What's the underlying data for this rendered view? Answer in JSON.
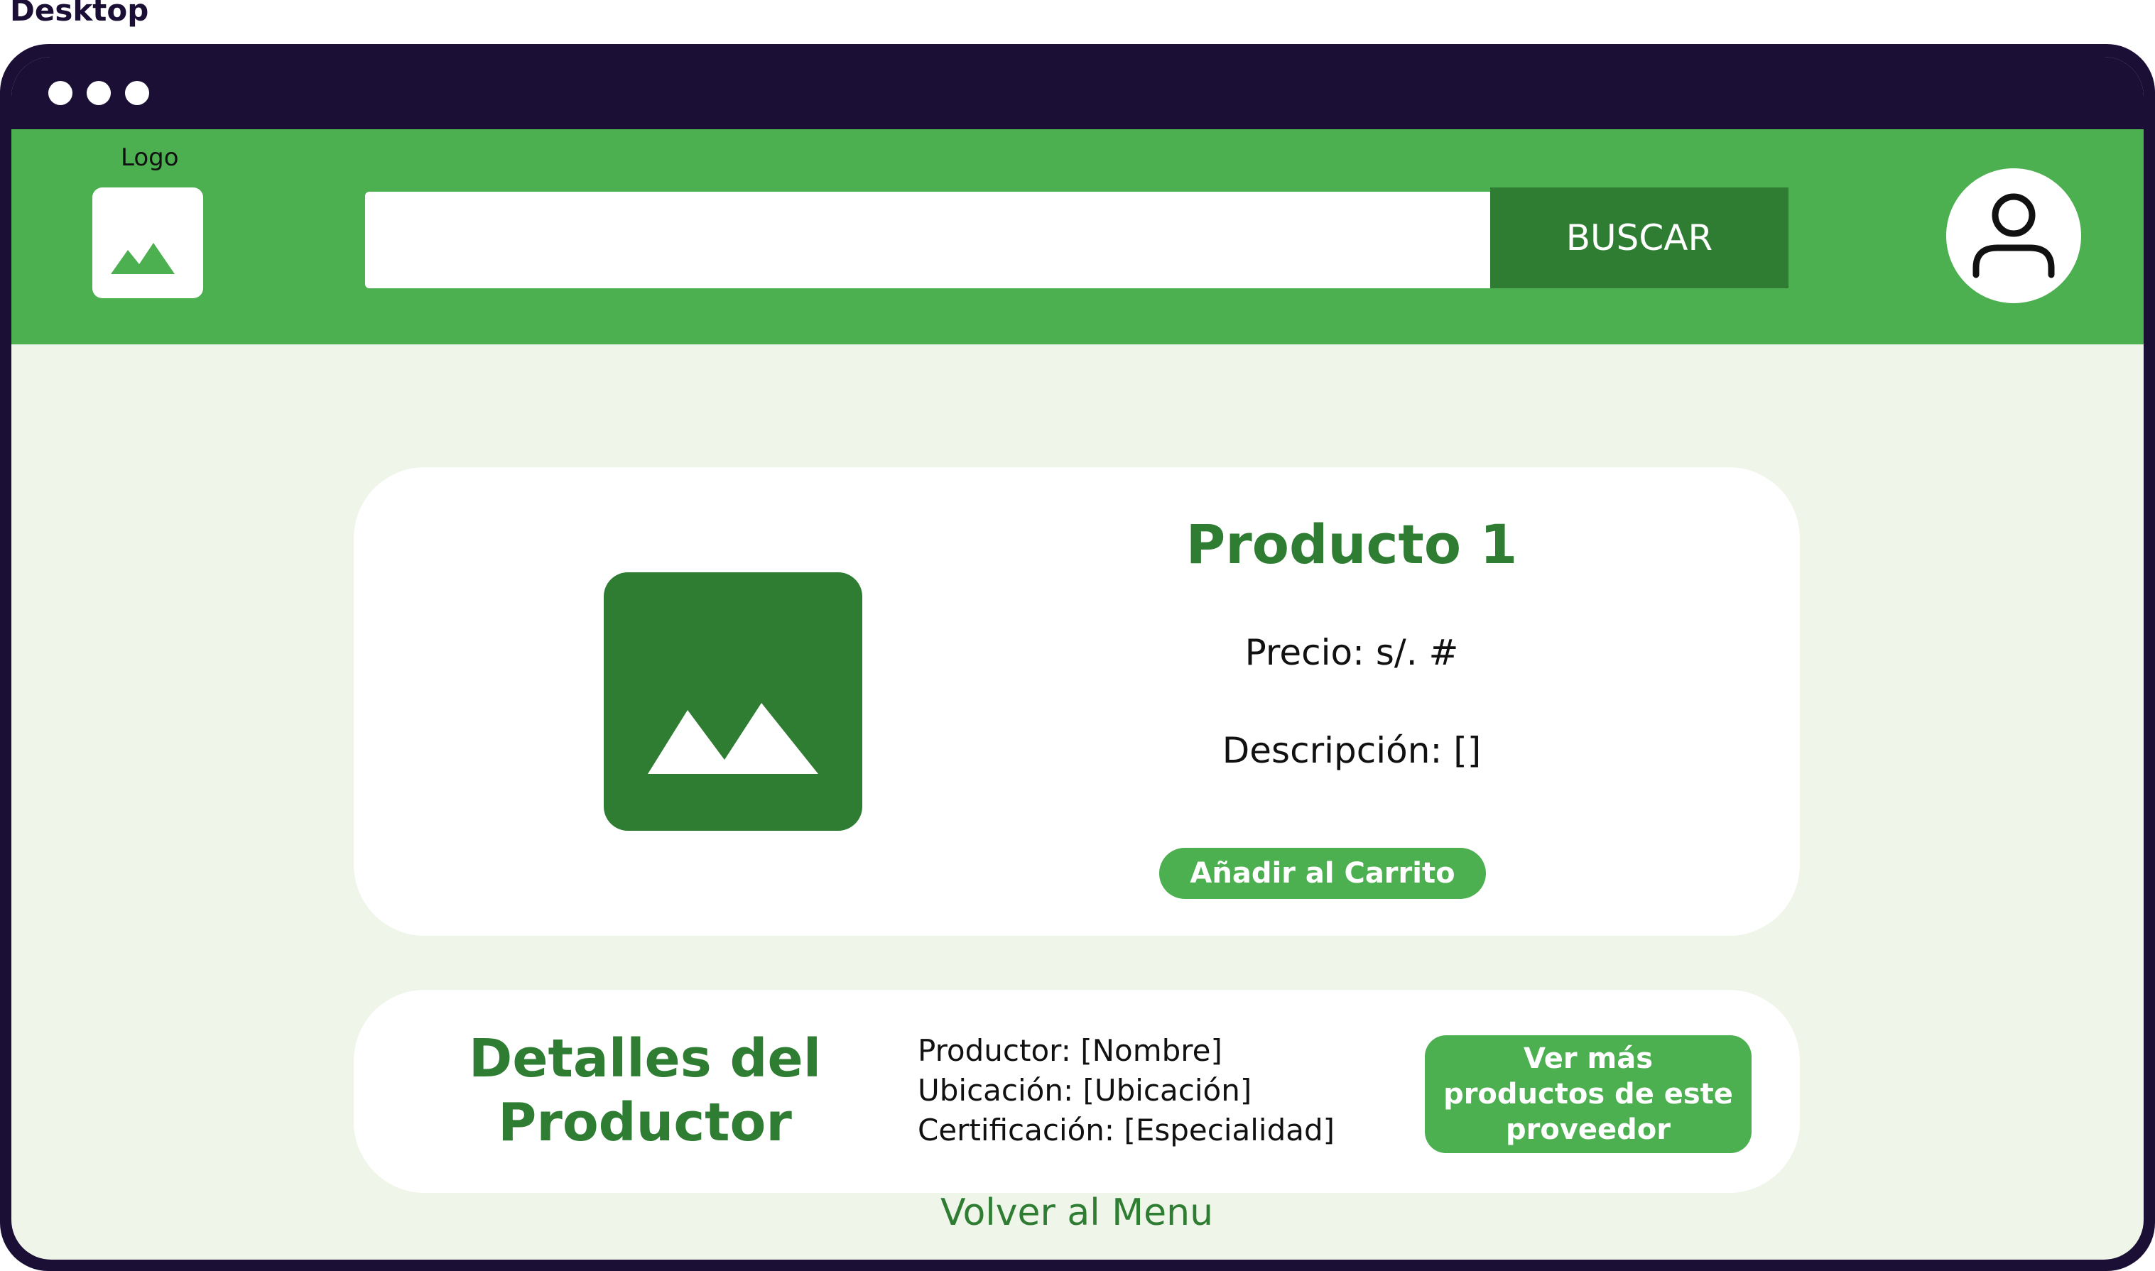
{
  "frame": {
    "label": "Desktop"
  },
  "colors": {
    "window_frame": "#1b0f35",
    "header_green": "#4caf50",
    "dark_green": "#2e7d32",
    "page_background": "#eff5e9",
    "card_background": "#ffffff"
  },
  "header": {
    "logo_label": "Logo",
    "logo_icon": "image-placeholder-icon",
    "search": {
      "placeholder": "",
      "value": ""
    },
    "search_button_label": "BUSCAR",
    "user_icon": "user-icon"
  },
  "product": {
    "title": "Producto 1",
    "price": "Precio: s/. #",
    "description": "Descripción: []",
    "image_icon": "image-placeholder-icon",
    "add_to_cart_label": "Añadir al Carrito"
  },
  "producer": {
    "title_line1": "Detalles del",
    "title_line2": "Productor",
    "name": "Productor: [Nombre]",
    "location": "Ubicación: [Ubicación]",
    "certification": "Certificación: [Especialidad]",
    "more_products_line1": "Ver más",
    "more_products_line2": "productos de este",
    "more_products_line3": "proveedor"
  },
  "footer": {
    "back_link": "Volver al Menu"
  }
}
